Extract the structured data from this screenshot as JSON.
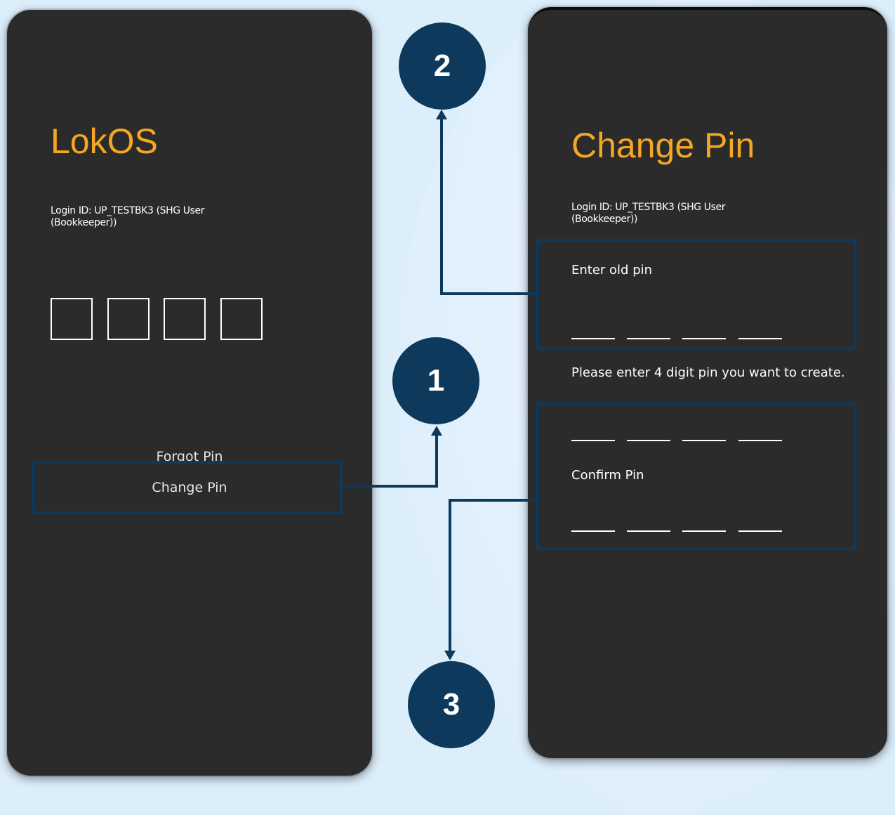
{
  "left_screen": {
    "app_title": "LokOS",
    "login_id": "Login ID: UP_TESTBK3 (SHG User (Bookkeeper))",
    "pin_inputs": [
      "",
      "",
      "",
      ""
    ],
    "forgot_pin_label": "Forgot Pin",
    "change_pin_label": "Change Pin"
  },
  "right_screen": {
    "title": "Change Pin",
    "login_id": "Login ID: UP_TESTBK3 (SHG User (Bookkeeper))",
    "old_pin_label": "Enter old pin",
    "new_pin_instruction": "Please enter 4 digit pin you want to create.",
    "confirm_pin_label": "Confirm Pin"
  },
  "callouts": [
    "1",
    "2",
    "3"
  ],
  "colors": {
    "background": "#ddeefb",
    "phone": "#2b2b2b",
    "title_accent": "#f6a722",
    "annotation": "#0d3a5c"
  }
}
